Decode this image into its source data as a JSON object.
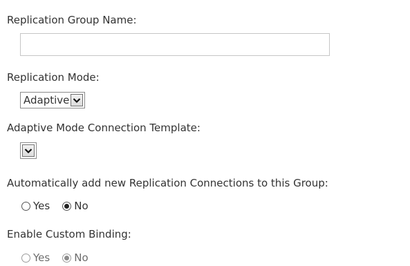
{
  "fields": {
    "group_name": {
      "label": "Replication Group Name:",
      "value": "",
      "placeholder": ""
    },
    "replication_mode": {
      "label": "Replication Mode:",
      "selected": "Adaptive"
    },
    "connection_template": {
      "label": "Adaptive Mode Connection Template:",
      "selected": ""
    },
    "auto_add": {
      "label": "Automatically add new Replication Connections to this Group:",
      "options": [
        {
          "label": "Yes",
          "checked": false
        },
        {
          "label": "No",
          "checked": true
        }
      ]
    },
    "custom_binding": {
      "label": "Enable Custom Binding:",
      "disabled": true,
      "options": [
        {
          "label": "Yes",
          "checked": false
        },
        {
          "label": "No",
          "checked": true
        }
      ]
    }
  },
  "icons": {
    "dropdown": "chevron-down-icon"
  }
}
